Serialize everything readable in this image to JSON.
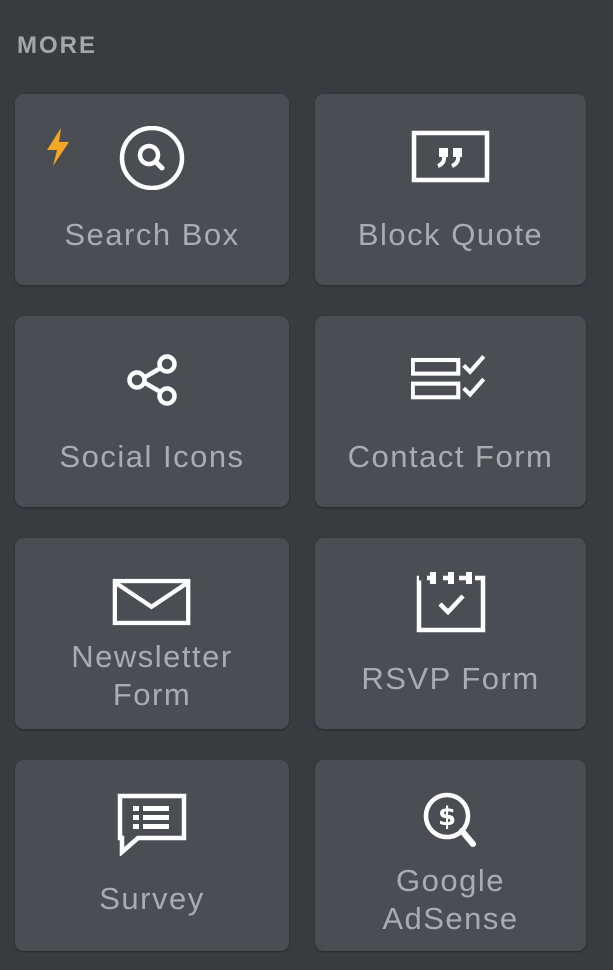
{
  "section": {
    "title": "MORE"
  },
  "tiles": [
    {
      "label": "Search Box",
      "icon": "search-icon",
      "badge": "lightning-bolt-icon"
    },
    {
      "label": "Block Quote",
      "icon": "quote-icon"
    },
    {
      "label": "Social Icons",
      "icon": "share-icon"
    },
    {
      "label": "Contact Form",
      "icon": "form-checklist-icon"
    },
    {
      "label": "Newsletter\nForm",
      "icon": "envelope-icon"
    },
    {
      "label": "RSVP Form",
      "icon": "calendar-check-icon"
    },
    {
      "label": "Survey",
      "icon": "speech-list-icon"
    },
    {
      "label": "Google\nAdSense",
      "icon": "dollar-search-icon"
    }
  ],
  "colors": {
    "panel_bg": "#393c3f",
    "tile_bg": "#4a4e52",
    "label": "#a9adb0",
    "icon": "#ffffff",
    "accent": "#f5a623"
  }
}
